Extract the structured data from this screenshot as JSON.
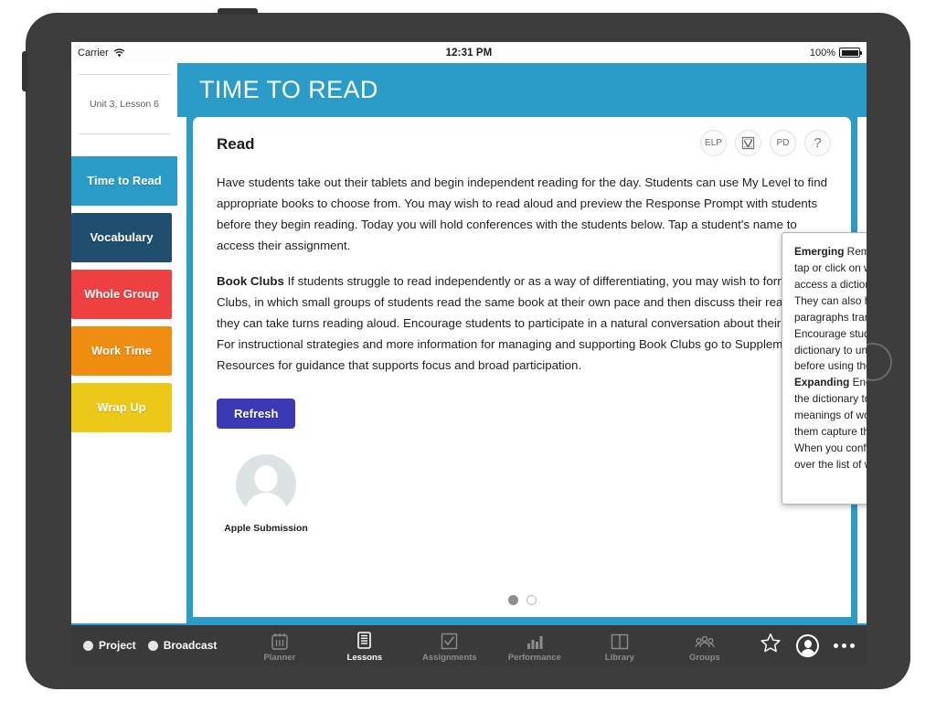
{
  "statusbar": {
    "carrier": "Carrier",
    "wifi_icon": "wifi-icon",
    "time": "12:31 PM",
    "battery_percent": "100%",
    "battery_icon": "battery-full-icon"
  },
  "sidebar": {
    "unit_label": "Unit 3, Lesson 6",
    "items": [
      {
        "label": "Time to Read",
        "color": "#2b9cc7",
        "active": true
      },
      {
        "label": "Vocabulary",
        "color": "#1f4e6e",
        "active": false
      },
      {
        "label": "Whole Group",
        "color": "#ee4040",
        "active": false
      },
      {
        "label": "Work Time",
        "color": "#ef8d11",
        "active": false
      },
      {
        "label": "Wrap Up",
        "color": "#ecc919",
        "active": false
      }
    ]
  },
  "hero": {
    "title": "TIME TO READ",
    "bg_color": "#2b9cc7"
  },
  "card": {
    "heading": "Read",
    "icon_buttons": [
      {
        "label": "ELP",
        "name": "elp-button"
      },
      {
        "label": "",
        "name": "assessment-clipboard-button"
      },
      {
        "label": "PD",
        "name": "pd-button"
      },
      {
        "label": "?",
        "name": "help-button"
      }
    ],
    "paragraph1": "Have students take out their tablets and begin independent reading for the day. Students can use My Level to find appropriate books to choose from. You may wish to read aloud and preview the Response Prompt with students before they begin reading. Today you will hold conferences with the students below. Tap a student's name to access their assignment.",
    "paragraph2_lead": "Book Clubs",
    "paragraph2": " If students struggle to read independently or as a way of differentiating, you may wish to form Book Clubs, in which small groups of students read the same book at their own pace and then discuss their reading; or they can take turns reading aloud. Encourage students to participate in a natural conversation about their book. For instructional strategies and more information for managing and supporting Book Clubs go to Supplemental Resources for guidance that supports focus and broad participation.",
    "refresh_label": "Refresh",
    "refresh_color": "#3b39b5",
    "student_name": "Apple Submission",
    "pager": {
      "total": 2,
      "active_index": 0
    }
  },
  "tooltip": {
    "section1_lead": "Emerging",
    "section1_text": " Remind students that they can tap or click on words they don't know to access a dictionary or picture dictionary. They can also have words or whole paragraphs translated with audio support. Encourage students to try using the dictionary to unlock meaning of the words before using the translation feature.",
    "section2_lead": "Expanding",
    "section2_text": " Encourage students to use the dictionary to help them determine the meanings of words they don't know. Have them capture the words in their Notes. When you conference with students, go over the list of words they've captured."
  },
  "toolbar": {
    "toggles": [
      {
        "label": "Project",
        "name": "project-toggle"
      },
      {
        "label": "Broadcast",
        "name": "broadcast-toggle"
      }
    ],
    "items": [
      {
        "label": "Planner",
        "icon": "calendar-icon",
        "active": false
      },
      {
        "label": "Lessons",
        "icon": "book-lines-icon",
        "active": true
      },
      {
        "label": "Assignments",
        "icon": "checkbox-icon",
        "active": false
      },
      {
        "label": "Performance",
        "icon": "bar-chart-icon",
        "active": false
      },
      {
        "label": "Library",
        "icon": "open-book-icon",
        "active": false
      },
      {
        "label": "Groups",
        "icon": "people-icon",
        "active": false
      }
    ],
    "right": [
      {
        "name": "favorites-star-icon"
      },
      {
        "name": "profile-avatar-button"
      },
      {
        "name": "overflow-menu-icon"
      }
    ],
    "accent_color": "#2b9cc7",
    "bg_color": "#3a3a3a"
  }
}
